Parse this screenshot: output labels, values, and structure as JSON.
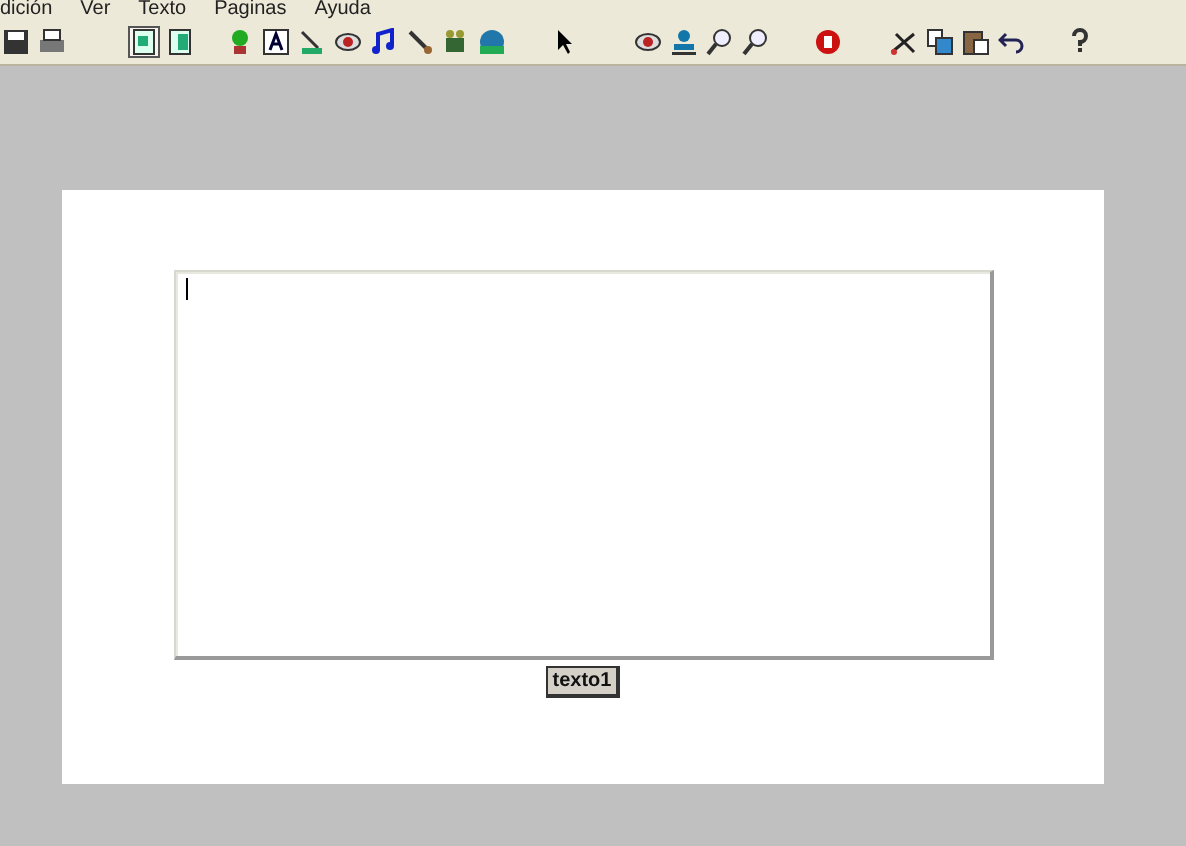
{
  "menu": [
    {
      "label": "dición"
    },
    {
      "label": "Ver"
    },
    {
      "label": "Texto"
    },
    {
      "label": "Paginas"
    },
    {
      "label": "Ayuda"
    }
  ],
  "toolbar": [
    [
      {
        "kind": "save",
        "selected": false
      },
      {
        "kind": "print",
        "selected": false
      }
    ],
    [
      {
        "kind": "page",
        "selected": true
      },
      {
        "kind": "pages",
        "selected": false
      }
    ],
    [
      {
        "kind": "plant",
        "selected": false
      },
      {
        "kind": "textbox",
        "selected": false
      },
      {
        "kind": "line",
        "selected": false
      },
      {
        "kind": "eye",
        "selected": false
      },
      {
        "kind": "music",
        "selected": false
      },
      {
        "kind": "brush",
        "selected": false
      },
      {
        "kind": "film",
        "selected": false
      },
      {
        "kind": "globe",
        "selected": false
      }
    ],
    [
      {
        "kind": "pointer",
        "selected": false
      }
    ],
    [
      {
        "kind": "eye",
        "selected": false
      },
      {
        "kind": "stamp",
        "selected": false
      },
      {
        "kind": "zoom",
        "selected": false
      },
      {
        "kind": "zoom",
        "selected": false
      }
    ],
    [
      {
        "kind": "stop",
        "selected": false
      }
    ],
    [
      {
        "kind": "scissors",
        "selected": false
      },
      {
        "kind": "copy",
        "selected": false
      },
      {
        "kind": "paste",
        "selected": false
      },
      {
        "kind": "undo",
        "selected": false
      }
    ],
    [
      {
        "kind": "help",
        "selected": false
      }
    ]
  ],
  "textbox": {
    "label": "texto1",
    "focused": true
  }
}
